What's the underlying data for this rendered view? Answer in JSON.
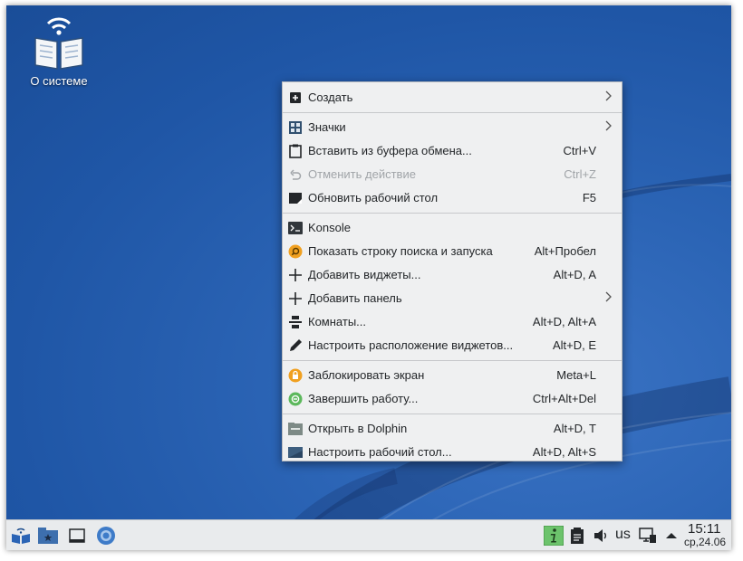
{
  "desktop": {
    "icon_label": "О системе"
  },
  "menu": {
    "items": [
      {
        "label": "Создать",
        "shortcut": "",
        "icon": "new-document-icon"
      },
      {
        "label": "Значки",
        "shortcut": "",
        "icon": "icons-grid-icon"
      },
      {
        "label": "Вставить из буфера обмена...",
        "shortcut": "Ctrl+V",
        "icon": "clipboard-paste-icon"
      },
      {
        "label": "Отменить действие",
        "shortcut": "Ctrl+Z",
        "icon": "undo-icon"
      },
      {
        "label": "Обновить рабочий стол",
        "shortcut": "F5",
        "icon": "refresh-desktop-icon"
      },
      {
        "label": "Konsole",
        "shortcut": "",
        "icon": "terminal-icon"
      },
      {
        "label": "Показать строку поиска и запуска",
        "shortcut": "Alt+Пробел",
        "icon": "krunner-search-icon"
      },
      {
        "label": "Добавить виджеты...",
        "shortcut": "Alt+D, A",
        "icon": "add-widgets-icon"
      },
      {
        "label": "Добавить панель",
        "shortcut": "",
        "icon": "add-panel-icon"
      },
      {
        "label": "Комнаты...",
        "shortcut": "Alt+D, Alt+A",
        "icon": "activities-icon"
      },
      {
        "label": "Настроить расположение виджетов...",
        "shortcut": "Alt+D, E",
        "icon": "edit-layout-icon"
      },
      {
        "label": "Заблокировать экран",
        "shortcut": "Meta+L",
        "icon": "lock-screen-icon"
      },
      {
        "label": "Завершить работу...",
        "shortcut": "Ctrl+Alt+Del",
        "icon": "leave-icon"
      },
      {
        "label": "Открыть в Dolphin",
        "shortcut": "Alt+D, T",
        "icon": "dolphin-folder-icon"
      },
      {
        "label": "Настроить рабочий стол...",
        "shortcut": "Alt+D, Alt+S",
        "icon": "desktop-settings-icon"
      }
    ]
  },
  "taskbar": {
    "keyboard_layout": "us",
    "clock_time": "15:11",
    "clock_date": "ср,24.06"
  },
  "colors": {
    "desktop_bg": "#2b64b5",
    "menu_bg": "#eff0f1",
    "taskbar_bg": "#e9ebed",
    "accent_green": "#5cb85c",
    "icon_orange": "#f0a020"
  }
}
